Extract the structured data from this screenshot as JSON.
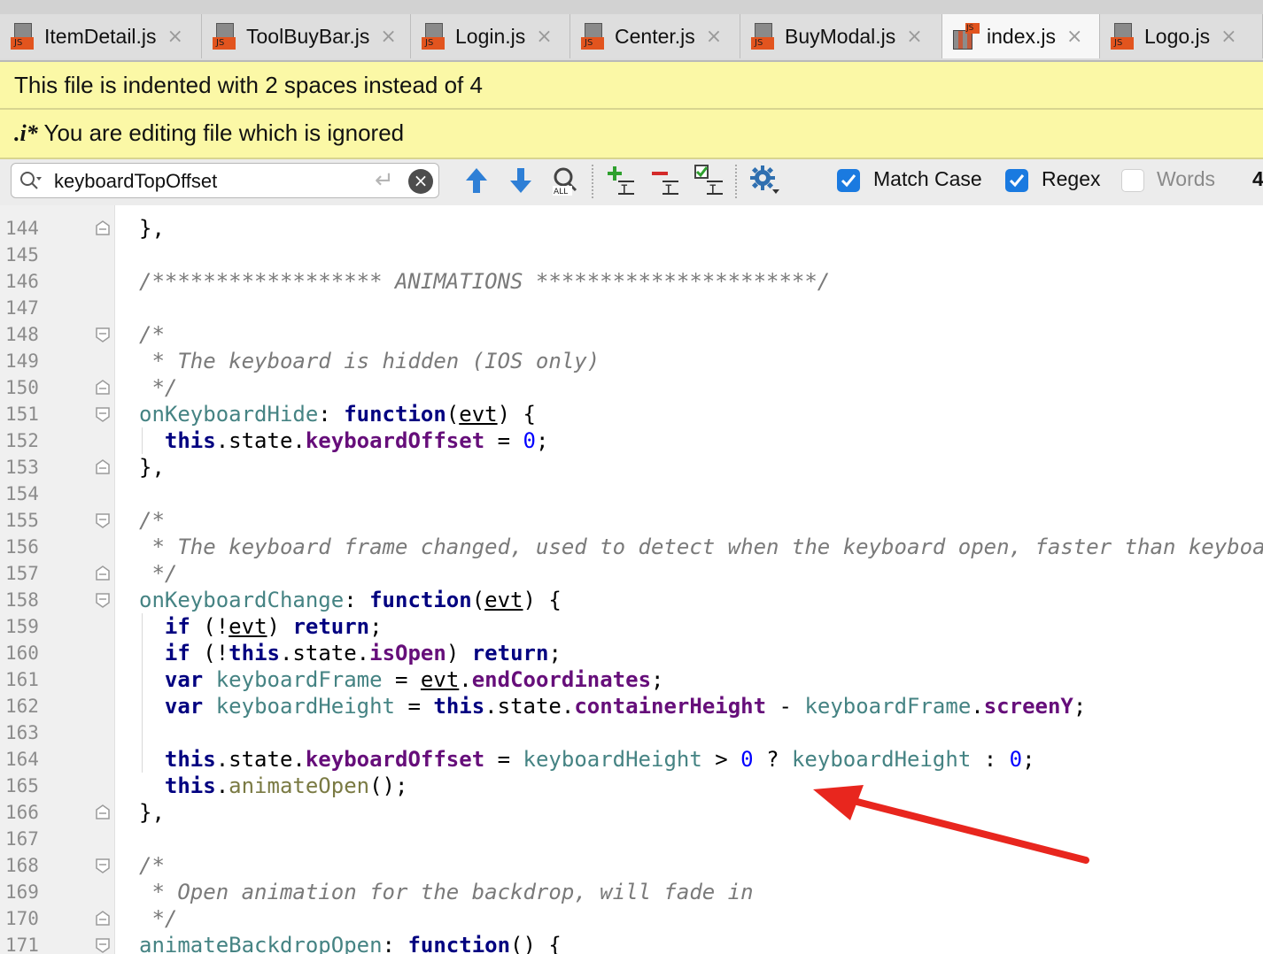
{
  "tabs": [
    {
      "label": "ItemDetail.js",
      "icon": "js-file-icon",
      "active": false
    },
    {
      "label": "ToolBuyBar.js",
      "icon": "js-file-icon",
      "active": false
    },
    {
      "label": "Login.js",
      "icon": "js-file-icon",
      "active": false
    },
    {
      "label": "Center.js",
      "icon": "js-file-icon",
      "active": false
    },
    {
      "label": "BuyModal.js",
      "icon": "js-file-icon",
      "active": false
    },
    {
      "label": "index.js",
      "icon": "js-file-icon",
      "active": true
    },
    {
      "label": "Logo.js",
      "icon": "js-file-icon",
      "active": false
    }
  ],
  "badge_text": "JS",
  "close_glyph": "×",
  "notices": {
    "indent": "This file is indented with 2 spaces instead of 4",
    "ignored_prefix": ".i*",
    "ignored": " You are editing file which is ignored"
  },
  "search": {
    "value": "keyboardTopOffset",
    "match_case_label": "Match Case",
    "match_case_checked": true,
    "regex_label": "Regex",
    "regex_checked": true,
    "words_label": "Words",
    "words_checked": false,
    "count_partial": "4"
  },
  "editor": {
    "first_line": 144,
    "lines": [
      {
        "n": "144",
        "code": "},",
        "fold": "end"
      },
      {
        "n": "145",
        "code": ""
      },
      {
        "n": "146",
        "code": "/****************** ANIMATIONS **********************/",
        "type": "comment"
      },
      {
        "n": "147",
        "code": ""
      },
      {
        "n": "148",
        "code": "/*",
        "type": "comment",
        "fold": "start"
      },
      {
        "n": "149",
        "code": " * The keyboard is hidden (IOS only)",
        "type": "comment"
      },
      {
        "n": "150",
        "code": " */",
        "type": "comment",
        "fold": "end"
      },
      {
        "n": "151",
        "code": "onKeyboardHide: function(evt) {",
        "fold": "start"
      },
      {
        "n": "152",
        "code": "  this.state.keyboardOffset = 0;"
      },
      {
        "n": "153",
        "code": "},",
        "fold": "end"
      },
      {
        "n": "154",
        "code": ""
      },
      {
        "n": "155",
        "code": "/*",
        "type": "comment",
        "fold": "start"
      },
      {
        "n": "156",
        "code": " * The keyboard frame changed, used to detect when the keyboard open, faster than keyboardD",
        "type": "comment"
      },
      {
        "n": "157",
        "code": " */",
        "type": "comment",
        "fold": "end"
      },
      {
        "n": "158",
        "code": "onKeyboardChange: function(evt) {",
        "fold": "start"
      },
      {
        "n": "159",
        "code": "  if (!evt) return;"
      },
      {
        "n": "160",
        "code": "  if (!this.state.isOpen) return;"
      },
      {
        "n": "161",
        "code": "  var keyboardFrame = evt.endCoordinates;"
      },
      {
        "n": "162",
        "code": "  var keyboardHeight = this.state.containerHeight - keyboardFrame.screenY;"
      },
      {
        "n": "163",
        "code": ""
      },
      {
        "n": "164",
        "code": "  this.state.keyboardOffset = keyboardHeight > 0 ? keyboardHeight : 0;"
      },
      {
        "n": "165",
        "code": "  this.animateOpen();"
      },
      {
        "n": "166",
        "code": "},",
        "fold": "end"
      },
      {
        "n": "167",
        "code": ""
      },
      {
        "n": "168",
        "code": "/*",
        "type": "comment",
        "fold": "start"
      },
      {
        "n": "169",
        "code": " * Open animation for the backdrop, will fade in",
        "type": "comment"
      },
      {
        "n": "170",
        "code": " */",
        "type": "comment",
        "fold": "end"
      },
      {
        "n": "171",
        "code": "animateBackdropOpen: function() {",
        "fold": "start"
      }
    ]
  },
  "colors": {
    "keyword": "#000080",
    "field": "#660e7a",
    "property": "#458383",
    "number": "#0000ff",
    "comment": "#7a7a7a",
    "notice_bg": "#fbf8a6",
    "arrow": "#e8261e"
  }
}
